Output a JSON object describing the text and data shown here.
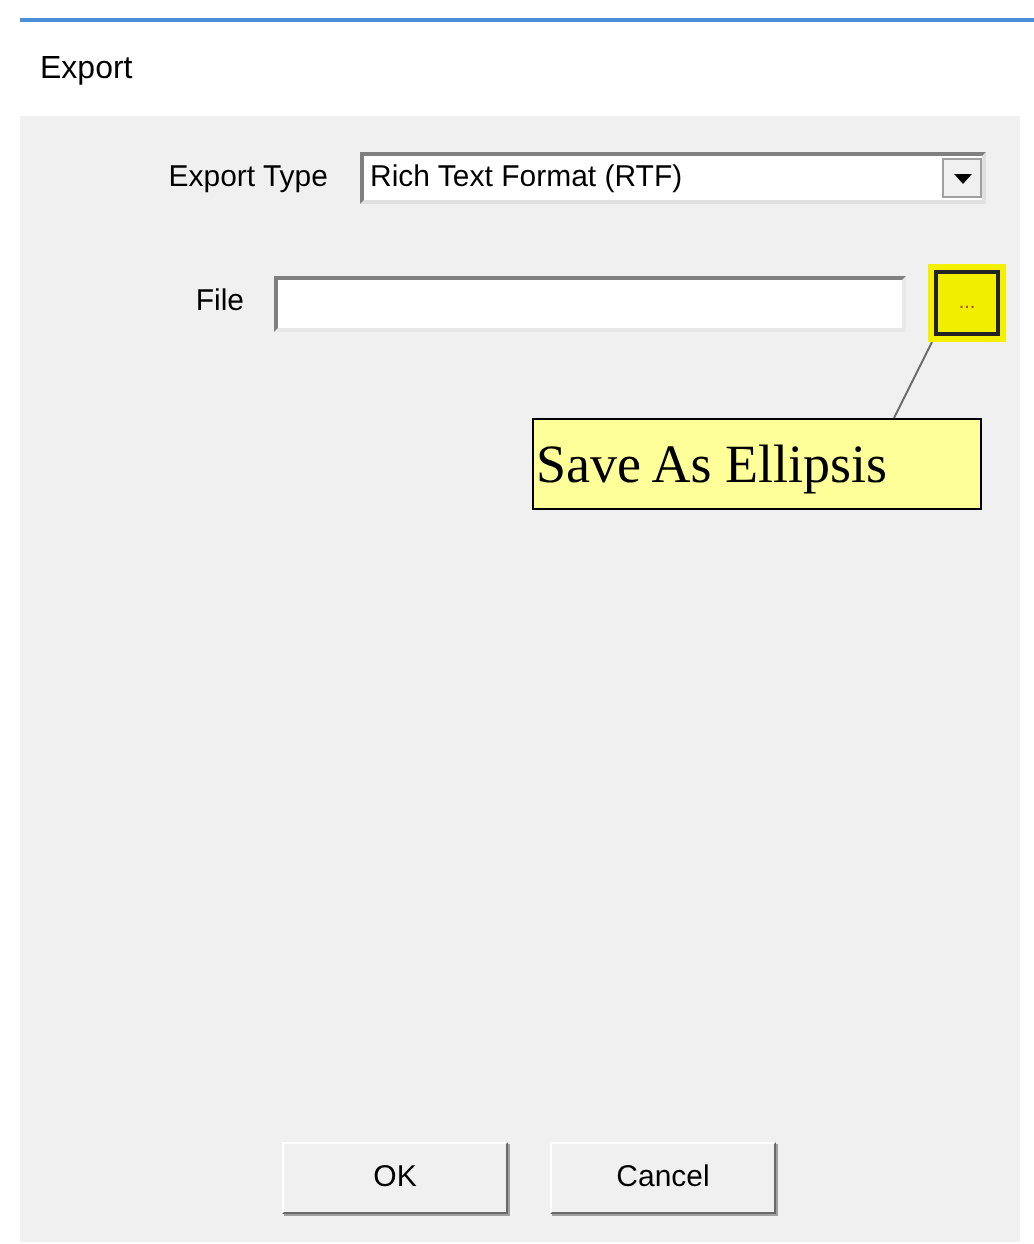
{
  "window": {
    "title": "Export"
  },
  "export_type": {
    "label": "Export Type",
    "value": "Rich Text Format (RTF)"
  },
  "file": {
    "label": "File",
    "browse_button": "...",
    "highlighted": true
  },
  "callout": {
    "text": "Save As Ellipsis"
  },
  "buttons": [
    "OK",
    "Cancel"
  ]
}
